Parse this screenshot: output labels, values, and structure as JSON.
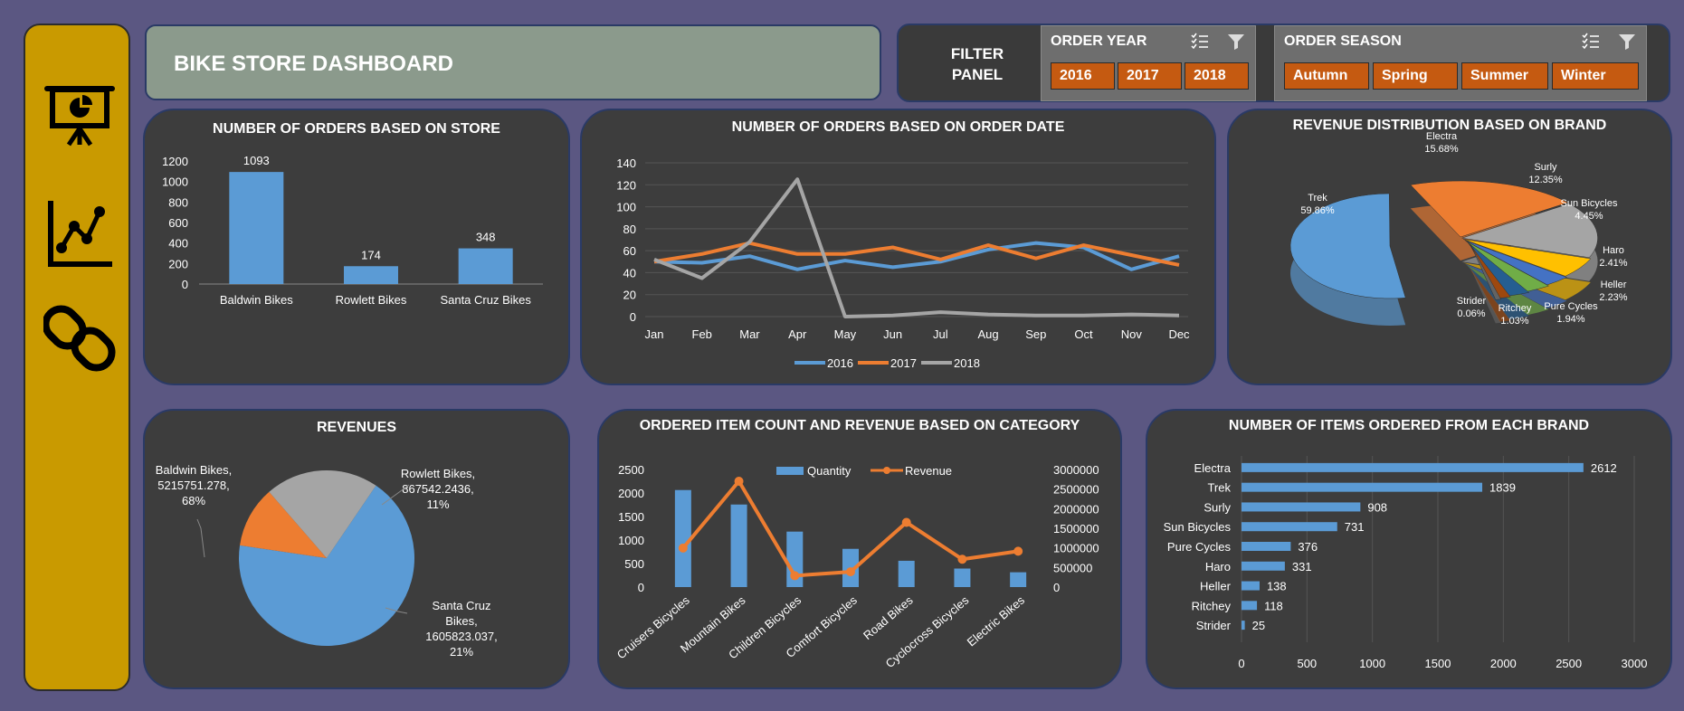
{
  "dashboard_title": "BIKE STORE DASHBOARD",
  "filter_panel": {
    "label_line1": "FILTER",
    "label_line2": "PANEL",
    "order_year": {
      "header": "ORDER YEAR",
      "options": [
        "2016",
        "2017",
        "2018"
      ]
    },
    "order_season": {
      "header": "ORDER SEASON",
      "options": [
        "Autumn",
        "Spring",
        "Summer",
        "Winter"
      ]
    }
  },
  "nav": [
    "presentation-icon",
    "line-chart-icon",
    "link-icon"
  ],
  "colors": {
    "blue": "#5b9bd5",
    "orange": "#ed7d31",
    "gray": "#a5a5a5",
    "panel": "#3d3d3d",
    "sidebar": "#c99a00",
    "chip": "#c55a11"
  },
  "chart_data": [
    {
      "id": "orders_by_store",
      "type": "bar",
      "title": "NUMBER OF ORDERS BASED ON STORE",
      "categories": [
        "Baldwin Bikes",
        "Rowlett Bikes",
        "Santa Cruz Bikes"
      ],
      "values": [
        1093,
        174,
        348
      ],
      "yticks": [
        0,
        200,
        400,
        600,
        800,
        1000,
        1200
      ],
      "ylim": [
        0,
        1200
      ]
    },
    {
      "id": "orders_by_date",
      "type": "line",
      "title": "NUMBER OF ORDERS BASED ON ORDER DATE",
      "x": [
        "Jan",
        "Feb",
        "Mar",
        "Apr",
        "May",
        "Jun",
        "Jul",
        "Aug",
        "Sep",
        "Oct",
        "Nov",
        "Dec"
      ],
      "yticks": [
        0,
        20,
        40,
        60,
        80,
        100,
        120,
        140
      ],
      "ylim": [
        0,
        140
      ],
      "series": [
        {
          "name": "2016",
          "color": "#5b9bd5",
          "values": [
            50,
            49,
            55,
            43,
            51,
            45,
            50,
            61,
            67,
            63,
            43,
            55
          ]
        },
        {
          "name": "2017",
          "color": "#ed7d31",
          "values": [
            50,
            57,
            67,
            57,
            57,
            63,
            52,
            65,
            53,
            65,
            56,
            47
          ]
        },
        {
          "name": "2018",
          "color": "#a5a5a5",
          "values": [
            52,
            35,
            68,
            125,
            0,
            1,
            4,
            2,
            1,
            1,
            2,
            1
          ]
        }
      ]
    },
    {
      "id": "revenue_by_brand",
      "type": "pie",
      "title": "REVENUE DISTRIBUTION BASED ON BRAND",
      "slices": [
        {
          "name": "Trek",
          "pct": "59.86%",
          "value": 59.86,
          "color": "#5b9bd5"
        },
        {
          "name": "Electra",
          "pct": "15.68%",
          "value": 15.68,
          "color": "#ed7d31"
        },
        {
          "name": "Surly",
          "pct": "12.35%",
          "value": 12.35,
          "color": "#a5a5a5"
        },
        {
          "name": "Sun Bicycles",
          "pct": "4.45%",
          "value": 4.45,
          "color": "#ffc000"
        },
        {
          "name": "Haro",
          "pct": "2.41%",
          "value": 2.41,
          "color": "#4472c4"
        },
        {
          "name": "Heller",
          "pct": "2.23%",
          "value": 2.23,
          "color": "#70ad47"
        },
        {
          "name": "Pure Cycles",
          "pct": "1.94%",
          "value": 1.94,
          "color": "#255e91"
        },
        {
          "name": "Ritchey",
          "pct": "1.03%",
          "value": 1.03,
          "color": "#9e480e"
        },
        {
          "name": "Strider",
          "pct": "0.06%",
          "value": 0.06,
          "color": "#636363"
        }
      ]
    },
    {
      "id": "revenues_by_store",
      "type": "pie",
      "title": "REVENUES",
      "slices": [
        {
          "name": "Baldwin Bikes,",
          "value": 5215751.278,
          "value_label": "5215751.278,",
          "pct": "68%",
          "color": "#5b9bd5"
        },
        {
          "name": "Rowlett Bikes,",
          "value": 867542.2436,
          "value_label": "867542.2436,",
          "pct": "11%",
          "color": "#ed7d31"
        },
        {
          "name": "Santa Cruz Bikes,",
          "value": 1605823.037,
          "value_label": "1605823.037,",
          "pct": "21%",
          "color": "#a5a5a5"
        }
      ],
      "label_lines": {
        "baldwin": [
          "Baldwin Bikes,",
          "5215751.278,",
          "68%"
        ],
        "rowlett": [
          "Rowlett Bikes,",
          "867542.2436,",
          "11%"
        ],
        "santacruz": [
          "Santa Cruz",
          "Bikes,",
          "1605823.037,",
          "21%"
        ]
      }
    },
    {
      "id": "category_combo",
      "type": "bar",
      "title": "ORDERED ITEM COUNT AND REVENUE BASED ON CATEGORY",
      "categories": [
        "Cruisers Bicycles",
        "Mountain Bikes",
        "Children Bicycles",
        "Comfort Bicycles",
        "Road Bikes",
        "Cyclocross Bicycles",
        "Electric Bikes"
      ],
      "series": [
        {
          "name": "Quantity",
          "kind": "bar",
          "axis": "left",
          "color": "#5b9bd5",
          "values": [
            2063,
            1755,
            1179,
            813,
            559,
            394,
            315
          ]
        },
        {
          "name": "Revenue",
          "kind": "line",
          "axis": "right",
          "color": "#ed7d31",
          "values": [
            995000,
            2700000,
            290000,
            390000,
            1650000,
            710000,
            915000
          ]
        }
      ],
      "yticks_left": [
        0,
        500,
        1000,
        1500,
        2000,
        2500
      ],
      "ylim_left": [
        0,
        2500
      ],
      "yticks_right": [
        0,
        500000,
        1000000,
        1500000,
        2000000,
        2500000,
        3000000
      ],
      "ylim_right": [
        0,
        3000000
      ]
    },
    {
      "id": "items_by_brand",
      "type": "bar",
      "orientation": "horizontal",
      "title": "NUMBER OF ITEMS ORDERED FROM EACH BRAND",
      "categories": [
        "Electra",
        "Trek",
        "Surly",
        "Sun Bicycles",
        "Pure Cycles",
        "Haro",
        "Heller",
        "Ritchey",
        "Strider"
      ],
      "values": [
        2612,
        1839,
        908,
        731,
        376,
        331,
        138,
        118,
        25
      ],
      "xticks": [
        0,
        500,
        1000,
        1500,
        2000,
        2500,
        3000
      ],
      "xlim": [
        0,
        3000
      ]
    }
  ]
}
